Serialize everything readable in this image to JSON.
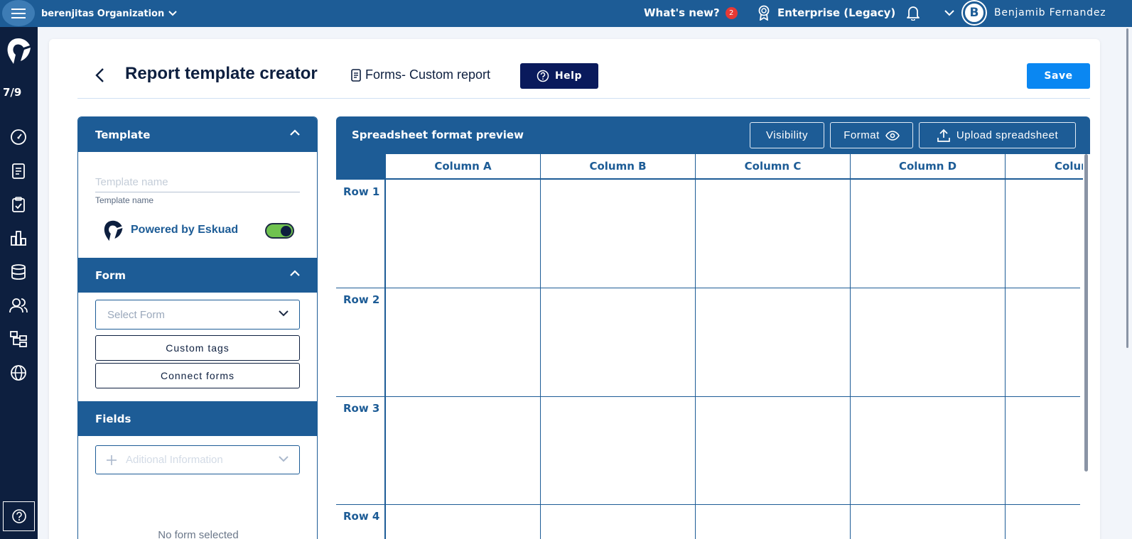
{
  "topbar": {
    "org_name": "berenjitas Organization",
    "whats_new": "What's new?",
    "whats_new_count": "2",
    "plan": "Enterprise (Legacy)",
    "user_initial": "B",
    "user_name": "Benjamib Fernandez"
  },
  "sidebar": {
    "counter": "7/9",
    "items": [
      {
        "icon": "dashboard-icon"
      },
      {
        "icon": "document-icon"
      },
      {
        "icon": "clipboard-icon"
      },
      {
        "icon": "chart-icon"
      },
      {
        "icon": "database-icon"
      },
      {
        "icon": "users-icon"
      },
      {
        "icon": "hierarchy-icon"
      },
      {
        "icon": "globe-icon"
      }
    ]
  },
  "page": {
    "title": "Report template creator",
    "subtitle": "Forms- Custom report",
    "help_label": "Help",
    "save_label": "Save"
  },
  "template_section": {
    "header": "Template",
    "name_placeholder": "Template name",
    "name_value": "",
    "name_helper": "Template name",
    "powered_label": "Powered by Eskuad",
    "powered_enabled": true
  },
  "form_section": {
    "header": "Form",
    "select_placeholder": "Select Form",
    "custom_tags_label": "Custom tags",
    "connect_forms_label": "Connect forms"
  },
  "fields_section": {
    "header": "Fields",
    "additional_placeholder": "Aditional Information",
    "empty_text": "No form selected"
  },
  "preview": {
    "title": "Spreadsheet format preview",
    "visibility_label": "Visibility",
    "format_label": "Format",
    "upload_label": "Upload spreadsheet",
    "columns": [
      "Column A",
      "Column B",
      "Column C",
      "Column D",
      "Column E"
    ],
    "rows": [
      "Row 1",
      "Row 2",
      "Row 3",
      "Row 4"
    ]
  },
  "colors": {
    "primary": "#1d5c96",
    "sidebar": "#0d1f3f",
    "help_button": "#0a1a5c",
    "save_button": "#0a87f2",
    "toggle_on": "#6fc24f",
    "badge": "#e53935"
  }
}
